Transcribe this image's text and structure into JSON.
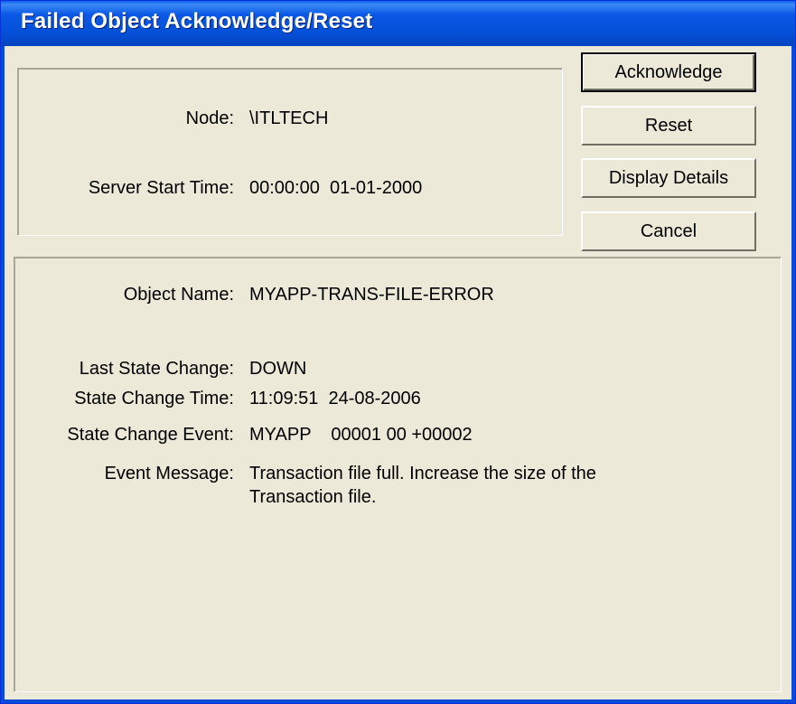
{
  "window": {
    "title": "Failed Object Acknowledge/Reset"
  },
  "buttons": {
    "acknowledge": "Acknowledge",
    "reset": "Reset",
    "display_details": "Display Details",
    "cancel": "Cancel"
  },
  "server": {
    "node_label": "Node:",
    "node_value": "\\ITLTECH",
    "start_time_label": "Server Start Time:",
    "start_time_value": "00:00:00  01-01-2000"
  },
  "object": {
    "name_label": "Object Name:",
    "name_value": "MYAPP-TRANS-FILE-ERROR",
    "last_state_label": "Last State Change:",
    "last_state_value": "DOWN",
    "change_time_label": "State Change Time:",
    "change_time_value": "11:09:51  24-08-2006",
    "change_event_label": "State Change Event:",
    "change_event_value": "MYAPP    00001 00 +00002",
    "message_label": "Event Message:",
    "message_line1": "Transaction file full. Increase the size of the",
    "message_line2": "Transaction file."
  }
}
